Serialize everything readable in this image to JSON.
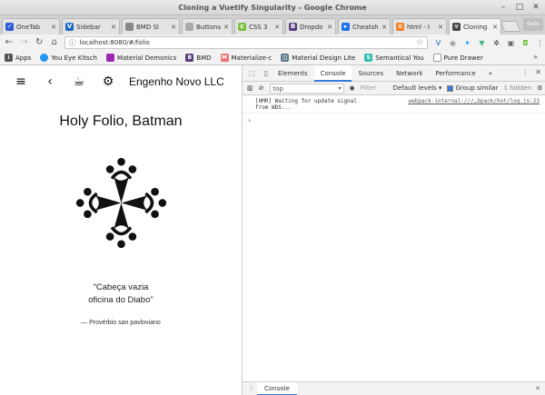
{
  "window": {
    "title": "Cloning a Vuetify Singularity - Google Chrome"
  },
  "tabs": [
    {
      "label": "OneTab",
      "icon": "onetab-icon",
      "color": "#2f5cd6"
    },
    {
      "label": "Sidebar",
      "icon": "vuetify-icon",
      "color": "#1867c0"
    },
    {
      "label": "BMD Sl",
      "icon": "page-icon",
      "color": "#888888"
    },
    {
      "label": "Buttons",
      "icon": "page-icon",
      "color": "#888888"
    },
    {
      "label": "CSS 3 ",
      "icon": "css-icon",
      "color": "#7bc043"
    },
    {
      "label": "Dropdo",
      "icon": "bootstrap-icon",
      "color": "#563d7c"
    },
    {
      "label": "Cheatsh",
      "icon": "cheatsheet-icon",
      "color": "#1a73e8"
    },
    {
      "label": "html - I",
      "icon": "stackoverflow-icon",
      "color": "#f48024"
    },
    {
      "label": "Cloning",
      "icon": "biohazard-icon",
      "color": "#444444"
    }
  ],
  "corner_badge": "Gelo",
  "address": {
    "url": "localhost:8080/#/folio"
  },
  "bookmarks": [
    {
      "label": "Apps",
      "icon": "apps-icon",
      "color": "#555555"
    },
    {
      "label": "You Eye Kitsch",
      "icon": "spinner-icon",
      "color": "#2196f3"
    },
    {
      "label": "Material Demonics",
      "icon": "material-icon",
      "color": "#9c27b0"
    },
    {
      "label": "BMD",
      "icon": "bootstrap-icon",
      "color": "#563d7c"
    },
    {
      "label": "Materialize-c",
      "icon": "materialize-icon",
      "color": "#ee6e73"
    },
    {
      "label": "Material Design Lite",
      "icon": "mdl-icon",
      "color": "#607d8b"
    },
    {
      "label": "Semantical You",
      "icon": "semantic-icon",
      "color": "#35bdb2"
    },
    {
      "label": "Pure Drawer",
      "icon": "page-icon",
      "color": "#888888"
    }
  ],
  "app": {
    "brand": "Engenho Novo LLC",
    "title": "Holy Folio, Batman",
    "quote_line1": "\"Cabeça vazia",
    "quote_line2": "oficina do Diabo\"",
    "attribution": "— Provérbio san pavloviano"
  },
  "devtools": {
    "tabs": [
      "Elements",
      "Console",
      "Sources",
      "Network",
      "Performance"
    ],
    "active_tab": "Console",
    "more": "»",
    "context": "top",
    "filter_placeholder": "Filter",
    "levels": "Default levels ▾",
    "group_similar": "Group similar",
    "hidden_count": "1 hidden",
    "log_text": "[HMR] Waiting for update signal from WDS...",
    "log_source": "webpack-internal:///…bpack/hot/log.js:23",
    "prompt": "›",
    "drawer_tab": "Console"
  }
}
